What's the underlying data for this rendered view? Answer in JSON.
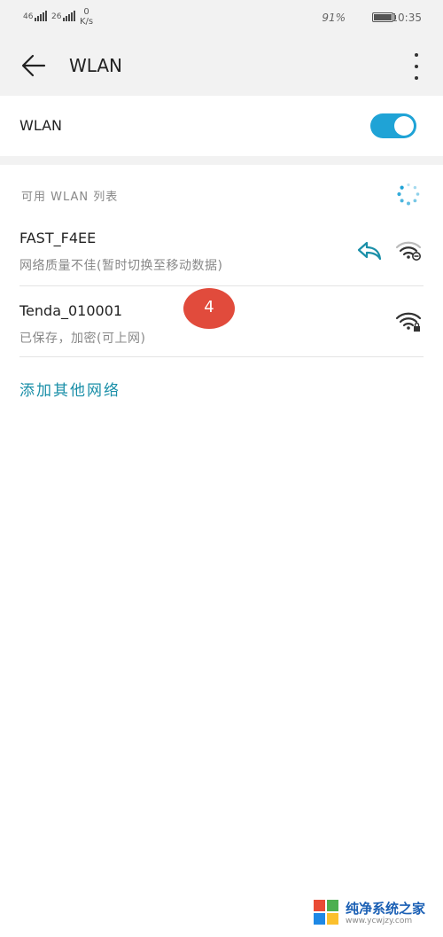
{
  "status_bar": {
    "sim1_label": "46",
    "sim2_label": "26",
    "net_speed_value": "0",
    "net_speed_unit": "K/s",
    "battery_percent": "91%",
    "time": "10:35"
  },
  "app_bar": {
    "title": "WLAN"
  },
  "wlan_toggle": {
    "label": "WLAN",
    "enabled": true
  },
  "available_section": {
    "label": "可用 WLAN 列表"
  },
  "networks": [
    {
      "name": "FAST_F4EE",
      "status": "网络质量不佳(暂时切换至移动数据)"
    },
    {
      "name": "Tenda_010001",
      "status": "已保存，加密(可上网)"
    }
  ],
  "annotation_badge": "4",
  "add_network": "添加其他网络",
  "watermark": {
    "main": "纯净系统之家",
    "sub": "www.ycwjzy.com"
  },
  "colors": {
    "accent": "#1fa3d6",
    "link": "#1a8fa8",
    "badge": "#e14b3c"
  }
}
